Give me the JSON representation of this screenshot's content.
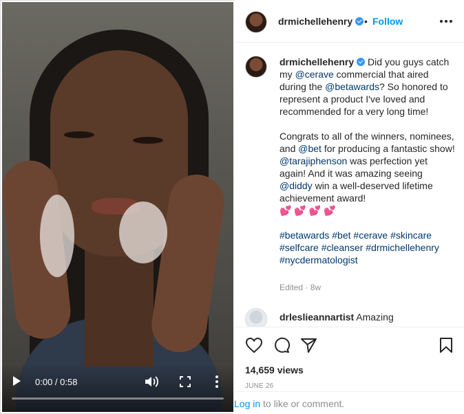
{
  "video": {
    "time": "0:00 / 0:58",
    "progress": 0.0
  },
  "header": {
    "username": "drmichellehenry",
    "separator": "•",
    "follow_label": "Follow"
  },
  "caption": {
    "username": "drmichellehenry",
    "para1": [
      {
        "text": " Did you guys catch my ",
        "link": false
      },
      {
        "text": "@cerave",
        "link": true
      },
      {
        "text": " commercial that aired during the ",
        "link": false
      },
      {
        "text": "@betawards",
        "link": true
      },
      {
        "text": "? So honored to represent a product I've loved and recommended for a very long time!",
        "link": false
      }
    ],
    "para2": [
      {
        "text": "Congrats to all of the winners, nominees, and ",
        "link": false
      },
      {
        "text": "@bet",
        "link": true
      },
      {
        "text": " for producing a fantastic show! ",
        "link": false
      },
      {
        "text": "@tarajiphenson",
        "link": true
      },
      {
        "text": " was perfection yet again! And it was amazing seeing ",
        "link": false
      },
      {
        "text": "@diddy",
        "link": true
      },
      {
        "text": " win a well-deserved lifetime achievement award!",
        "link": false
      }
    ],
    "hearts": "💕💕💕💕",
    "hashtags": "#betawards #bet #cerave #skincare #selfcare #cleanser #drmichellehenry #nycdermatologist",
    "edited": "Edited · 8w"
  },
  "comment": {
    "username": "drleslieannartist",
    "text": " Amazing"
  },
  "stats": {
    "views": "14,659 views",
    "date": "JUNE 26"
  },
  "login": {
    "link": "Log in",
    "rest": " to like or comment."
  },
  "colors": {
    "accent": "#0095f6",
    "link": "#00376b",
    "muted": "#8e8e8e",
    "verified": "#3897f0"
  },
  "icons": {
    "like": "heart-icon",
    "comment": "comment-icon",
    "share": "paper-plane-icon",
    "save": "bookmark-icon"
  }
}
